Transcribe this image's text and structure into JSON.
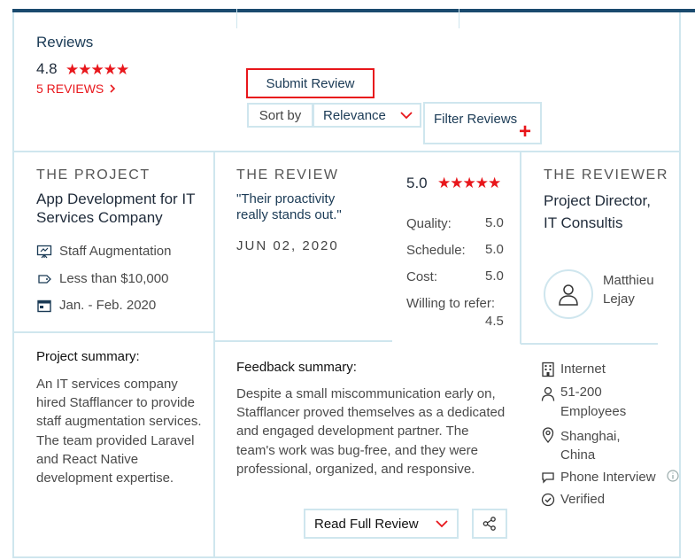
{
  "header": {
    "title": "Reviews",
    "rating": "4.8",
    "stars": "★★★★★",
    "reviews_link": "5 REVIEWS",
    "submit_label": "Submit Review",
    "sort_label": "Sort by",
    "sort_value": "Relevance",
    "filter_label": "Filter Reviews",
    "filter_plus": "+"
  },
  "project": {
    "section_title": "THE PROJECT",
    "name": "App Development for IT Services Company",
    "service": "Staff Augmentation",
    "budget": "Less than $10,000",
    "dates": "Jan. - Feb. 2020",
    "summary_title": "Project summary:",
    "summary_text": "An IT services company hired Stafflancer to provide staff augmentation services. The team provided Laravel and React Native development expertise."
  },
  "review": {
    "section_title": "THE REVIEW",
    "quote": "\"Their proactivity really stands out.\"",
    "date": "JUN 02, 2020",
    "overall": "5.0",
    "stars": "★★★★★",
    "scores": [
      {
        "label": "Quality:",
        "value": "5.0"
      },
      {
        "label": "Schedule:",
        "value": "5.0"
      },
      {
        "label": "Cost:",
        "value": "5.0"
      },
      {
        "label": "Willing to refer:",
        "value": "4.5"
      }
    ],
    "feedback_title": "Feedback summary:",
    "feedback_text": "Despite a small miscommunication early on, Stafflancer proved themselves as a dedicated and engaged development partner. The team's work was bug-free, and they were professional, organized, and responsive.",
    "read_full_label": "Read Full Review"
  },
  "reviewer": {
    "section_title": "THE REVIEWER",
    "role": "Project Director, IT Consultis",
    "name": "Matthieu Lejay",
    "industry": "Internet",
    "employees": "51-200 Employees",
    "location": "Shanghai, China",
    "review_type": "Phone Interview",
    "verified": "Verified"
  },
  "colors": {
    "accent_red": "#e8161b",
    "navy": "#1a4a6e",
    "border": "#cfe6ee"
  }
}
